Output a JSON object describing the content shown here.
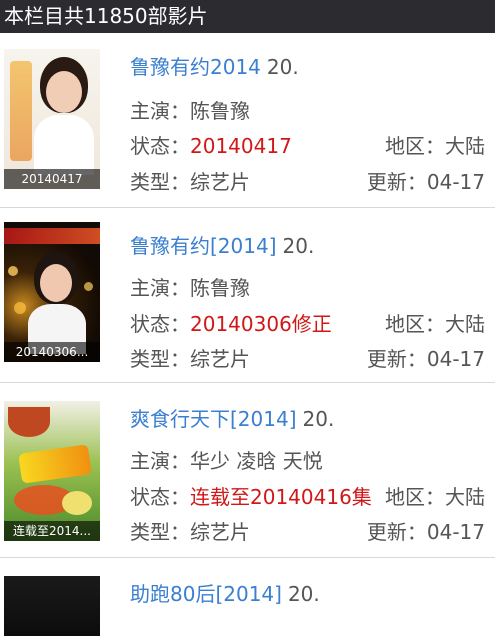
{
  "header": {
    "title": "本栏目共11850部影片"
  },
  "items": [
    {
      "thumb_caption": "20140417",
      "title": "鲁豫有约2014",
      "episode": "20.",
      "actors_label": "主演：",
      "actors": "陈鲁豫",
      "status_label": "状态：",
      "status": "20140417",
      "region_label": "地区：",
      "region": "大陆",
      "type_label": "类型：",
      "type": "综艺片",
      "updated_label": "更新：",
      "updated": "04-17"
    },
    {
      "thumb_caption": "20140306...",
      "title": "鲁豫有约[2014]",
      "episode": "20.",
      "actors_label": "主演：",
      "actors": "陈鲁豫",
      "status_label": "状态：",
      "status": "20140306修正",
      "region_label": "地区：",
      "region": "大陆",
      "type_label": "类型：",
      "type": "综艺片",
      "updated_label": "更新：",
      "updated": "04-17"
    },
    {
      "thumb_caption": "连载至2014...",
      "title": "爽食行天下[2014]",
      "episode": "20.",
      "actors_label": "主演：",
      "actors": "华少 凌晗 天悦",
      "status_label": "状态：",
      "status": "连载至20140416集",
      "region_label": "地区：",
      "region": "大陆",
      "type_label": "类型：",
      "type": "综艺片",
      "updated_label": "更新：",
      "updated": "04-17"
    },
    {
      "title": "助跑80后[2014]",
      "episode": "20."
    }
  ],
  "colors": {
    "header_bg": "#2c2c30",
    "title_blue": "#3a7fd0",
    "status_red": "#d01818"
  }
}
